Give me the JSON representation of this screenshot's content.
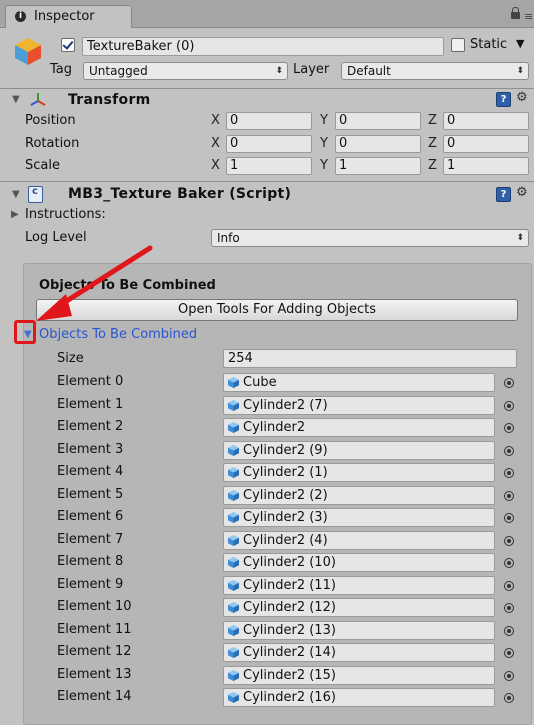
{
  "tab": {
    "title": "Inspector"
  },
  "header": {
    "object_name": "TextureBaker (0)",
    "static_label": "Static",
    "tag_label": "Tag",
    "tag_value": "Untagged",
    "layer_label": "Layer",
    "layer_value": "Default"
  },
  "transform": {
    "title": "Transform",
    "rows": [
      {
        "label": "Position",
        "x": "0",
        "y": "0",
        "z": "0"
      },
      {
        "label": "Rotation",
        "x": "0",
        "y": "0",
        "z": "0"
      },
      {
        "label": "Scale",
        "x": "1",
        "y": "1",
        "z": "1"
      }
    ],
    "axis": {
      "x": "X",
      "y": "Y",
      "z": "Z"
    }
  },
  "script": {
    "title": "MB3_Texture Baker (Script)",
    "instructions_label": "Instructions:",
    "log_level_label": "Log Level",
    "log_level_value": "Info",
    "section_title": "Objects To Be Combined",
    "open_tools_button": "Open Tools For Adding Objects",
    "list_label": "Objects To Be Combined",
    "size_label": "Size",
    "size_value": "254",
    "elements": [
      {
        "label": "Element 0",
        "value": "Cube"
      },
      {
        "label": "Element 1",
        "value": "Cylinder2 (7)"
      },
      {
        "label": "Element 2",
        "value": "Cylinder2"
      },
      {
        "label": "Element 3",
        "value": "Cylinder2 (9)"
      },
      {
        "label": "Element 4",
        "value": "Cylinder2 (1)"
      },
      {
        "label": "Element 5",
        "value": "Cylinder2 (2)"
      },
      {
        "label": "Element 6",
        "value": "Cylinder2 (3)"
      },
      {
        "label": "Element 7",
        "value": "Cylinder2 (4)"
      },
      {
        "label": "Element 8",
        "value": "Cylinder2 (10)"
      },
      {
        "label": "Element 9",
        "value": "Cylinder2 (11)"
      },
      {
        "label": "Element 10",
        "value": "Cylinder2 (12)"
      },
      {
        "label": "Element 11",
        "value": "Cylinder2 (13)"
      },
      {
        "label": "Element 12",
        "value": "Cylinder2 (14)"
      },
      {
        "label": "Element 13",
        "value": "Cylinder2 (15)"
      },
      {
        "label": "Element 14",
        "value": "Cylinder2 (16)"
      }
    ]
  },
  "colors": {
    "annotation_red": "#e0161a",
    "link_blue": "#2a55d0"
  }
}
